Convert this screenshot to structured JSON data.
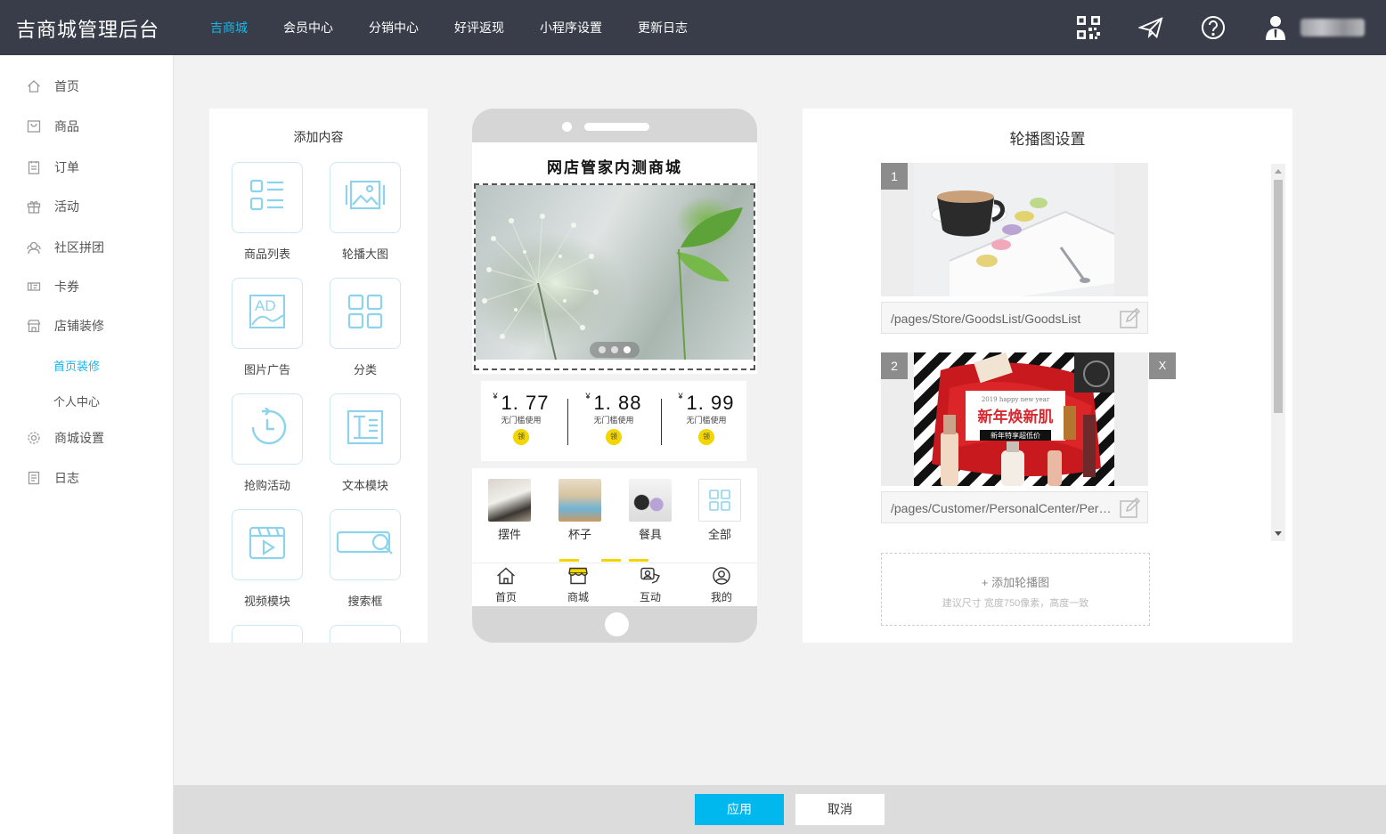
{
  "app": {
    "title": "吉商城管理后台"
  },
  "topnav": [
    {
      "label": "吉商城",
      "active": true
    },
    {
      "label": "会员中心"
    },
    {
      "label": "分销中心"
    },
    {
      "label": "好评返现"
    },
    {
      "label": "小程序设置"
    },
    {
      "label": "更新日志"
    }
  ],
  "header_icons": [
    "qrcode-icon",
    "send-icon",
    "help-icon",
    "user-icon"
  ],
  "sidebar": {
    "items": [
      {
        "label": "首页",
        "icon": "home-icon"
      },
      {
        "label": "商品",
        "icon": "goods-icon"
      },
      {
        "label": "订单",
        "icon": "order-icon"
      },
      {
        "label": "活动",
        "icon": "gift-icon"
      },
      {
        "label": "社区拼团",
        "icon": "group-icon"
      },
      {
        "label": "卡券",
        "icon": "coupon-icon"
      },
      {
        "label": "店铺装修",
        "icon": "store-icon"
      },
      {
        "label": "商城设置",
        "icon": "settings-icon"
      },
      {
        "label": "日志",
        "icon": "log-icon"
      }
    ],
    "subitems": [
      {
        "label": "首页装修",
        "active": true
      },
      {
        "label": "个人中心"
      }
    ]
  },
  "left_panel": {
    "title": "添加内容",
    "widgets": [
      {
        "label": "商品列表",
        "icon": "list-icon"
      },
      {
        "label": "轮播大图",
        "icon": "gallery-icon"
      },
      {
        "label": "图片广告",
        "icon": "ad-icon",
        "icon_text": "AD"
      },
      {
        "label": "分类",
        "icon": "grid-icon"
      },
      {
        "label": "抢购活动",
        "icon": "timer-icon"
      },
      {
        "label": "文本模块",
        "icon": "text-icon"
      },
      {
        "label": "视频模块",
        "icon": "video-icon"
      },
      {
        "label": "搜索框",
        "icon": "search-icon"
      }
    ]
  },
  "phone": {
    "store_title": "网店管家内测商城",
    "coupons": [
      {
        "currency": "¥",
        "amount": "1. 77",
        "condition": "无门槛使用",
        "button": "领"
      },
      {
        "currency": "¥",
        "amount": "1. 88",
        "condition": "无门槛使用",
        "button": "领"
      },
      {
        "currency": "¥",
        "amount": "1. 99",
        "condition": "无门槛使用",
        "button": "领"
      }
    ],
    "categories": [
      {
        "label": "摆件"
      },
      {
        "label": "杯子"
      },
      {
        "label": "餐具"
      },
      {
        "label": "全部"
      }
    ],
    "tabs": [
      {
        "label": "首页",
        "icon": "home-icon"
      },
      {
        "label": "商城",
        "icon": "shop-icon"
      },
      {
        "label": "互动",
        "icon": "interact-icon"
      },
      {
        "label": "我的",
        "icon": "profile-icon"
      }
    ]
  },
  "right_panel": {
    "title": "轮播图设置",
    "slides": [
      {
        "index": "1",
        "link": "/pages/Store/GoodsList/GoodsList"
      },
      {
        "index": "2",
        "link": "/pages/Customer/PersonalCenter/PersonalCenter",
        "delete_label": "X",
        "image_text": {
          "tagline": "2019 happy new year",
          "headline": "新年焕新肌",
          "sub": "新年特享超低价"
        }
      }
    ],
    "add_label": "+ 添加轮播图",
    "add_hint": "建议尺寸 宽度750像素，高度一致"
  },
  "footer": {
    "apply": "应用",
    "cancel": "取消"
  },
  "colors": {
    "accent": "#19b5e8",
    "topbar": "#393d49",
    "apply": "#00b7ee",
    "coupon_button": "#f3d500"
  }
}
